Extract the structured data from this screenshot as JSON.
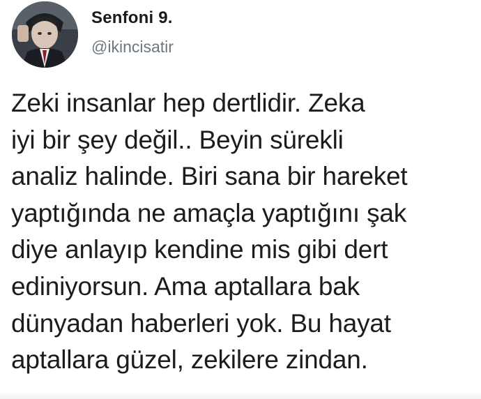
{
  "tweet": {
    "author": {
      "display_name": "Senfoni 9.",
      "handle": "@ikincisatir",
      "avatar_icon": "profile-photo-avatar"
    },
    "text_lines": [
      "Zeki insanlar hep dertlidir. Zeka",
      "iyi bir şey değil.. Beyin sürekli",
      "analiz halinde. Biri sana bir hareket",
      "yaptığında ne amaçla yaptığını şak",
      "diye anlayıp kendine mis gibi dert",
      "ediniyorsun. Ama aptallara bak",
      "dünyadan haberleri yok. Bu hayat",
      "aptallara güzel, zekilere zindan."
    ]
  },
  "colors": {
    "background": "#ffffff",
    "text": "#1c1c1c",
    "handle": "#6b7680"
  }
}
